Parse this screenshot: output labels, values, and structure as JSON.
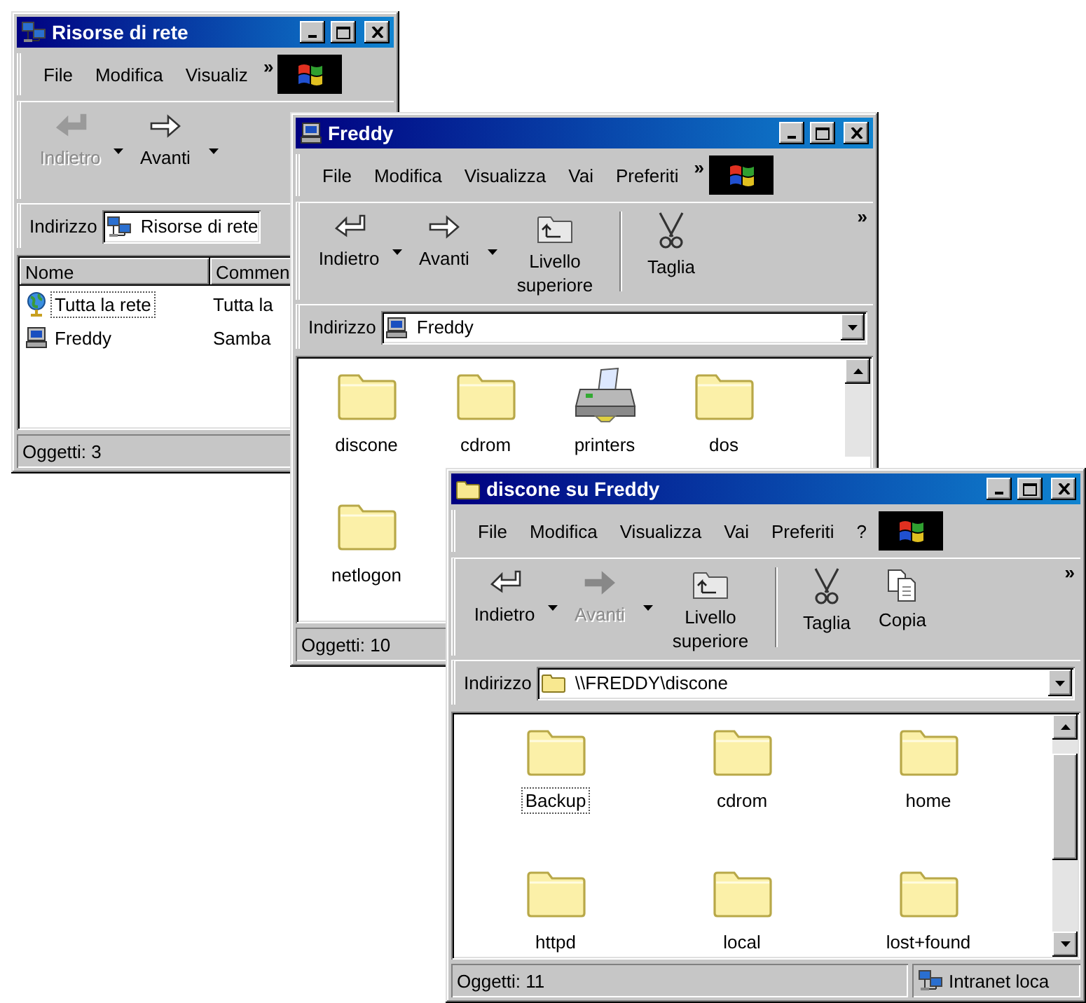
{
  "windows": [
    {
      "title": "Risorse di rete",
      "kind": "network",
      "menu": [
        "File",
        "Modifica",
        "Visualiz"
      ],
      "menu_more": "»",
      "toolbar": [
        {
          "kind": "back",
          "label": "Indietro",
          "disabled": true,
          "dropdown": true
        },
        {
          "kind": "forward",
          "label": "Avanti",
          "disabled": false,
          "dropdown": true
        }
      ],
      "address": {
        "label": "Indirizzo",
        "kind": "network",
        "value": "Risorse di rete"
      },
      "columns": [
        "Nome",
        "Commen"
      ],
      "rows": [
        {
          "kind": "globe",
          "name": "Tutta la rete",
          "comment": "Tutta la",
          "selected": true
        },
        {
          "kind": "computer",
          "name": "Freddy",
          "comment": "Samba",
          "selected": false
        }
      ],
      "status": [
        {
          "kind": "count",
          "text": "Oggetti: 3"
        }
      ]
    },
    {
      "title": "Freddy",
      "kind": "computer",
      "menu": [
        "File",
        "Modifica",
        "Visualizza",
        "Vai",
        "Preferiti"
      ],
      "menu_more": "»",
      "toolbar": [
        {
          "kind": "back",
          "label": "Indietro",
          "disabled": false,
          "dropdown": true
        },
        {
          "kind": "forward",
          "label": "Avanti",
          "disabled": false,
          "dropdown": true
        },
        {
          "kind": "up",
          "label": "Livello superiore",
          "disabled": false,
          "dropdown": false
        },
        {
          "kind": "separator"
        },
        {
          "kind": "cut",
          "label": "Taglia",
          "disabled": false,
          "dropdown": false
        }
      ],
      "toolbar_more": "»",
      "address": {
        "label": "Indirizzo",
        "kind": "computer",
        "value": "Freddy",
        "dropdown": true
      },
      "scrollbar": {
        "kind": "partial"
      },
      "items": [
        {
          "kind": "folder",
          "label": "discone",
          "selected": false
        },
        {
          "kind": "folder",
          "label": "cdrom",
          "selected": false
        },
        {
          "kind": "printer",
          "label": "printers",
          "selected": false
        },
        {
          "kind": "folder",
          "label": "dos",
          "selected": false
        },
        {
          "kind": "folder",
          "label": "netlogon",
          "selected": false
        }
      ],
      "status": [
        {
          "kind": "count",
          "text": "Oggetti: 10"
        }
      ]
    },
    {
      "title": "discone su Freddy",
      "kind": "folder",
      "menu": [
        "File",
        "Modifica",
        "Visualizza",
        "Vai",
        "Preferiti",
        "?"
      ],
      "toolbar": [
        {
          "kind": "back",
          "label": "Indietro",
          "disabled": false,
          "dropdown": true
        },
        {
          "kind": "forward",
          "label": "Avanti",
          "disabled": true,
          "dropdown": true
        },
        {
          "kind": "up",
          "label": "Livello superiore",
          "disabled": false,
          "dropdown": false
        },
        {
          "kind": "separator"
        },
        {
          "kind": "cut",
          "label": "Taglia",
          "disabled": false,
          "dropdown": false
        },
        {
          "kind": "copy",
          "label": "Copia",
          "disabled": false,
          "dropdown": false
        }
      ],
      "toolbar_more": "»",
      "address": {
        "label": "Indirizzo",
        "kind": "folder",
        "value": "\\\\FREDDY\\discone",
        "dropdown": true
      },
      "scrollbar": {
        "kind": "full"
      },
      "items": [
        {
          "kind": "folder",
          "label": "Backup",
          "selected": true
        },
        {
          "kind": "folder",
          "label": "cdrom",
          "selected": false
        },
        {
          "kind": "folder",
          "label": "home",
          "selected": false
        },
        {
          "kind": "folder",
          "label": "httpd",
          "selected": false
        },
        {
          "kind": "folder",
          "label": "local",
          "selected": false
        },
        {
          "kind": "folder",
          "label": "lost+found",
          "selected": false
        }
      ],
      "status": [
        {
          "kind": "count",
          "text": "Oggetti: 11"
        },
        {
          "kind": "zone",
          "text": "Intranet loca"
        }
      ]
    }
  ]
}
